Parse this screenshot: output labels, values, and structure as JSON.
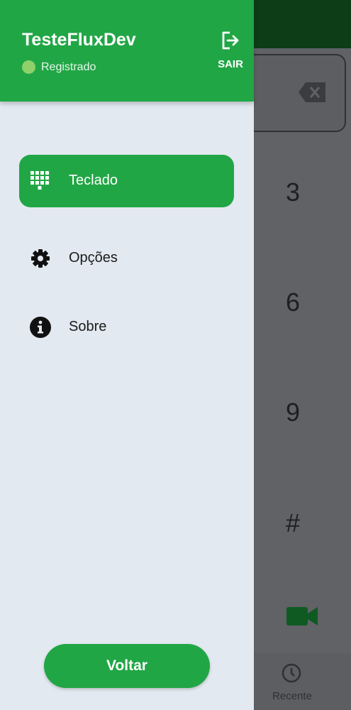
{
  "background_dialer": {
    "keys": [
      "3",
      "6",
      "9",
      "#"
    ],
    "recent_label": "Recente"
  },
  "drawer": {
    "account_name": "TesteFluxDev",
    "status_text": "Registrado",
    "logout_label": "SAIR",
    "menu": [
      {
        "label": "Teclado",
        "icon": "dialpad-icon",
        "active": true
      },
      {
        "label": "Opções",
        "icon": "gear-icon",
        "active": false
      },
      {
        "label": "Sobre",
        "icon": "info-icon",
        "active": false
      }
    ],
    "back_label": "Voltar"
  },
  "colors": {
    "primary_green": "#21a645",
    "status_green": "#8fd06a",
    "drawer_bg": "#e2e9f0",
    "top_bar_dark": "#0c3d16"
  }
}
